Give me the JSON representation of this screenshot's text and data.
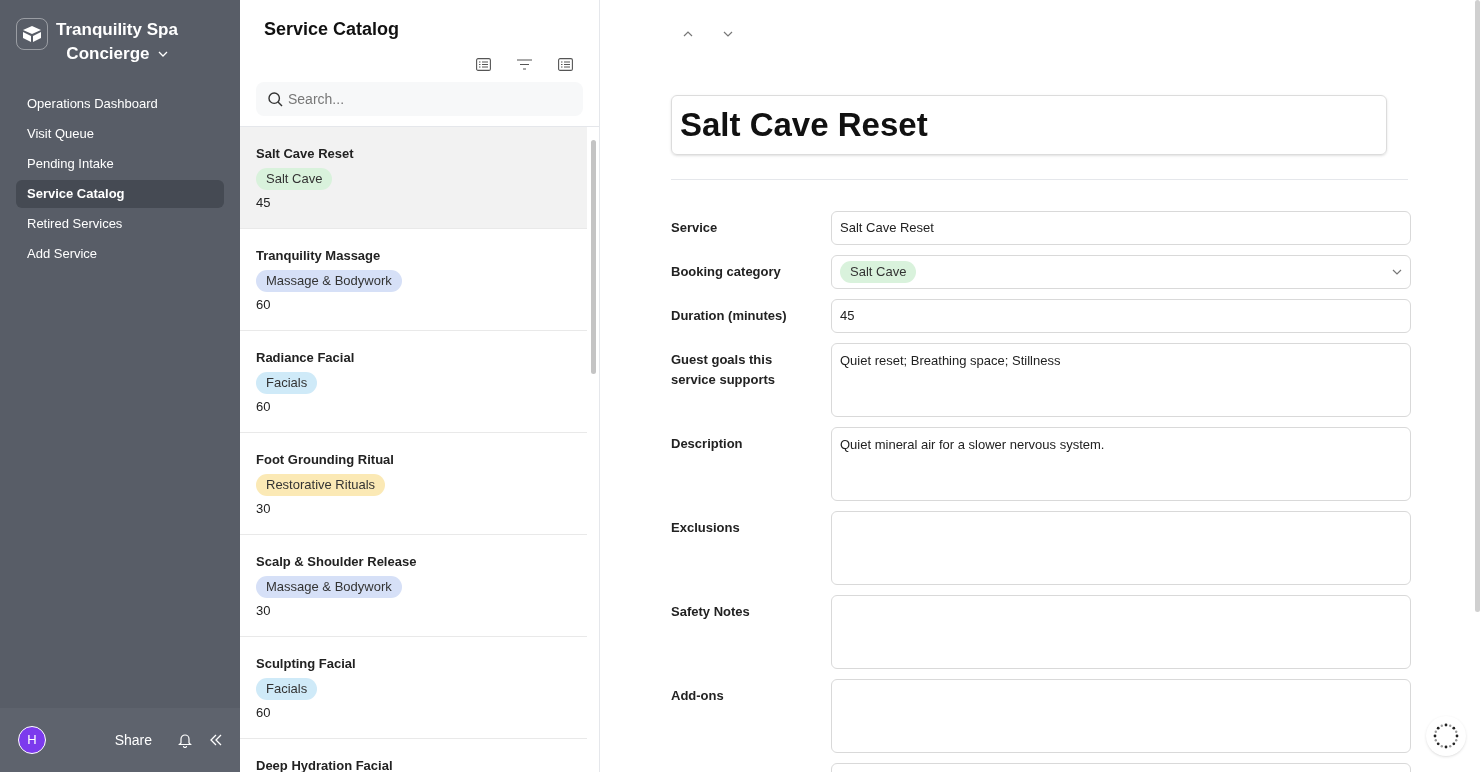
{
  "workspace": {
    "name_line_1": "Tranquility Spa",
    "name_line_2": "Concierge"
  },
  "nav": [
    {
      "label": "Operations Dashboard",
      "selected": false
    },
    {
      "label": "Visit Queue",
      "selected": false
    },
    {
      "label": "Pending Intake",
      "selected": false
    },
    {
      "label": "Service Catalog",
      "selected": true
    },
    {
      "label": "Retired Services",
      "selected": false
    },
    {
      "label": "Add Service",
      "selected": false
    }
  ],
  "footer": {
    "avatar": "H",
    "share": "Share"
  },
  "list": {
    "title": "Service Catalog",
    "search": {
      "placeholder": "Search..."
    },
    "items": [
      {
        "title": "Salt Cave Reset",
        "tag": "Salt Cave",
        "color": "#d9f2dc",
        "minutes": "45",
        "selected": true
      },
      {
        "title": "Tranquility Massage",
        "tag": "Massage & Bodywork",
        "color": "#d6e0f7",
        "minutes": "60",
        "selected": false
      },
      {
        "title": "Radiance Facial",
        "tag": "Facials",
        "color": "#cfeaf8",
        "minutes": "60",
        "selected": false
      },
      {
        "title": "Foot Grounding Ritual",
        "tag": "Restorative Rituals",
        "color": "#fbe9b5",
        "minutes": "30",
        "selected": false
      },
      {
        "title": "Scalp & Shoulder Release",
        "tag": "Massage & Bodywork",
        "color": "#d6e0f7",
        "minutes": "30",
        "selected": false
      },
      {
        "title": "Sculpting Facial",
        "tag": "Facials",
        "color": "#cfeaf8",
        "minutes": "60",
        "selected": false
      },
      {
        "title": "Deep Hydration Facial",
        "selected": false
      }
    ]
  },
  "detail": {
    "title": "Salt Cave Reset",
    "fields": [
      {
        "kind": "text",
        "label": "Service",
        "value": "Salt Cave Reset"
      },
      {
        "kind": "select",
        "label": "Booking category",
        "value": "Salt Cave",
        "color": "#d9f2dc"
      },
      {
        "kind": "text",
        "label": "Duration (minutes)",
        "value": "45"
      },
      {
        "kind": "textarea",
        "label": "Guest goals this service supports",
        "value": "Quiet reset; Breathing space; Stillness"
      },
      {
        "kind": "textarea",
        "label": "Description",
        "value": "Quiet mineral air for a slower nervous system."
      },
      {
        "kind": "textarea",
        "label": "Exclusions"
      },
      {
        "kind": "textarea",
        "label": "Safety Notes"
      },
      {
        "kind": "textarea",
        "label": "Add-ons"
      },
      {
        "kind": "textarea"
      }
    ]
  }
}
